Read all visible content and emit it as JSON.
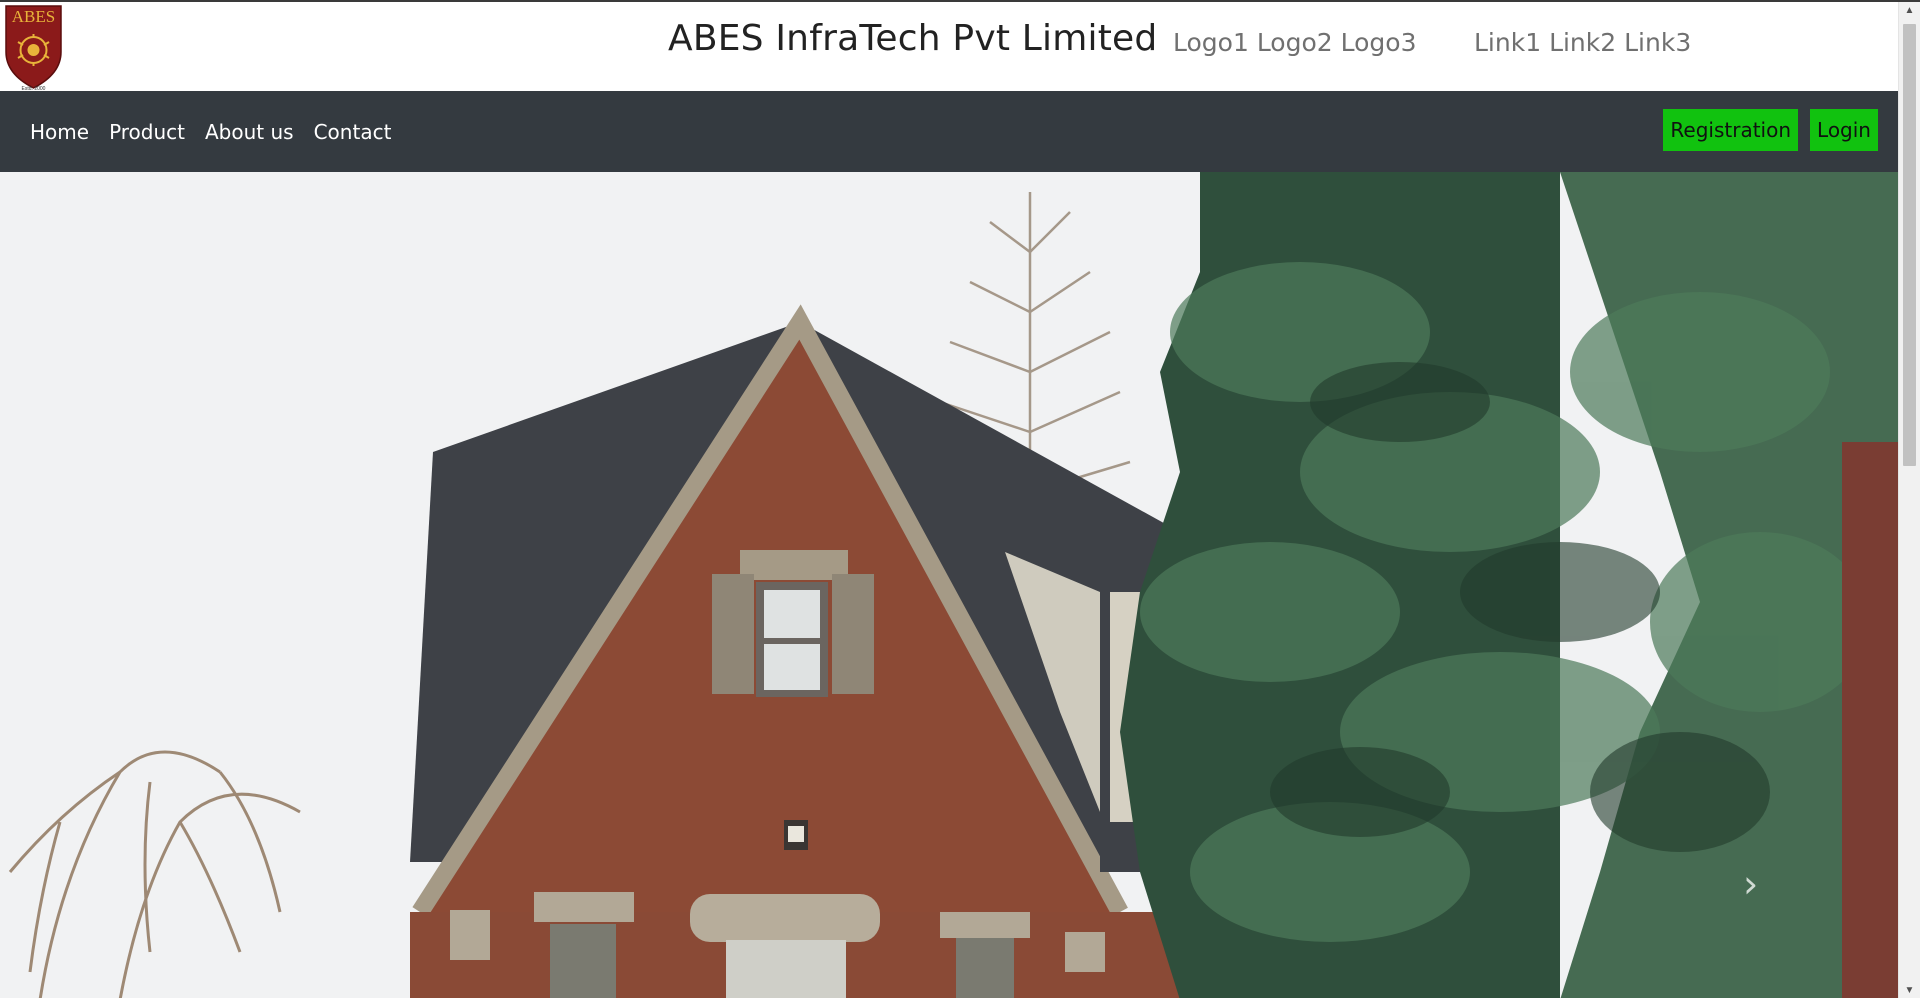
{
  "header": {
    "logo_text": "ABES",
    "logo_est": "Estd. 2000",
    "title": "ABES InfraTech Pvt Limited",
    "logos": [
      "Logo1",
      "Logo2",
      "Logo3"
    ],
    "links": [
      "Link1",
      "Link2",
      "Link3"
    ]
  },
  "nav": {
    "items": [
      "Home",
      "Product",
      "About us",
      "Contact"
    ],
    "registration_label": "Registration",
    "login_label": "Login"
  },
  "hero": {
    "next_label": "›"
  },
  "colors": {
    "navbar": "#343a40",
    "button": "#11c20f",
    "logo_red": "#8b1a1a",
    "logo_gold": "#e0a020"
  }
}
